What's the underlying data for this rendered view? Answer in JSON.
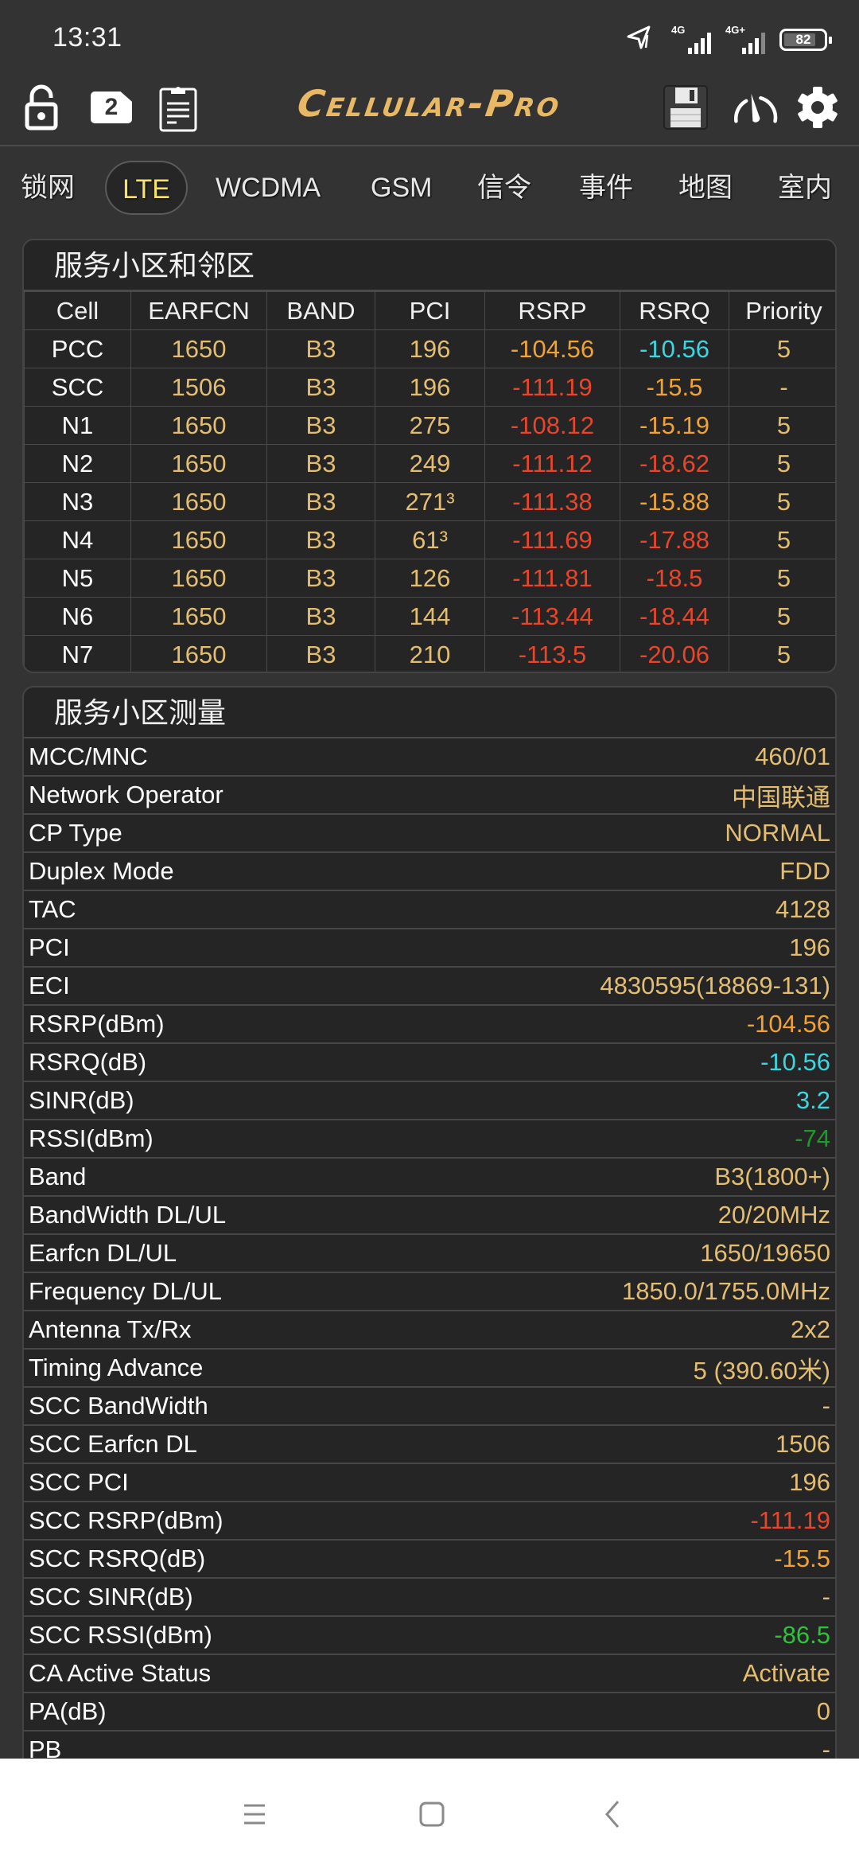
{
  "status_bar": {
    "time": "13:31",
    "sim1_network": "4G",
    "sim2_network": "4G+",
    "battery_level": "82"
  },
  "toolbar": {
    "app_title": "Cellular-Pro",
    "sim_slot": "2",
    "logo_color": "#e8b865"
  },
  "tabs": [
    {
      "label": "锁网",
      "active": false
    },
    {
      "label": "LTE",
      "active": true
    },
    {
      "label": "WCDMA",
      "active": false
    },
    {
      "label": "GSM",
      "active": false
    },
    {
      "label": "信令",
      "active": false
    },
    {
      "label": "事件",
      "active": false
    },
    {
      "label": "地图",
      "active": false
    },
    {
      "label": "室内",
      "active": false
    }
  ],
  "colors": {
    "gold": "#e3bd72",
    "orange": "#f0a234",
    "red": "#e8452a",
    "cyan": "#3dd6e0",
    "green": "#2ec43a",
    "dark_green": "#1f9a2a",
    "active_tab": "#f5e36a"
  },
  "cells_section": {
    "title": "服务小区和邻区",
    "columns": [
      "Cell",
      "EARFCN",
      "BAND",
      "PCI",
      "RSRP",
      "RSRQ",
      "Priority"
    ],
    "rows": [
      {
        "cell": "PCC",
        "earfcn": "1650",
        "band": "B3",
        "pci": "196",
        "rsrp": "-104.56",
        "rsrp_color": "orange",
        "rsrq": "-10.56",
        "rsrq_color": "cyan",
        "priority": "5"
      },
      {
        "cell": "SCC",
        "earfcn": "1506",
        "band": "B3",
        "pci": "196",
        "rsrp": "-111.19",
        "rsrp_color": "red",
        "rsrq": "-15.5",
        "rsrq_color": "orange",
        "priority": "-"
      },
      {
        "cell": "N1",
        "earfcn": "1650",
        "band": "B3",
        "pci": "275",
        "rsrp": "-108.12",
        "rsrp_color": "red",
        "rsrq": "-15.19",
        "rsrq_color": "orange",
        "priority": "5"
      },
      {
        "cell": "N2",
        "earfcn": "1650",
        "band": "B3",
        "pci": "249",
        "rsrp": "-111.12",
        "rsrp_color": "red",
        "rsrq": "-18.62",
        "rsrq_color": "red",
        "priority": "5"
      },
      {
        "cell": "N3",
        "earfcn": "1650",
        "band": "B3",
        "pci": "271³",
        "rsrp": "-111.38",
        "rsrp_color": "red",
        "rsrq": "-15.88",
        "rsrq_color": "orange",
        "priority": "5"
      },
      {
        "cell": "N4",
        "earfcn": "1650",
        "band": "B3",
        "pci": "61³",
        "rsrp": "-111.69",
        "rsrp_color": "red",
        "rsrq": "-17.88",
        "rsrq_color": "red",
        "priority": "5"
      },
      {
        "cell": "N5",
        "earfcn": "1650",
        "band": "B3",
        "pci": "126",
        "rsrp": "-111.81",
        "rsrp_color": "red",
        "rsrq": "-18.5",
        "rsrq_color": "red",
        "priority": "5"
      },
      {
        "cell": "N6",
        "earfcn": "1650",
        "band": "B3",
        "pci": "144",
        "rsrp": "-113.44",
        "rsrp_color": "red",
        "rsrq": "-18.44",
        "rsrq_color": "red",
        "priority": "5"
      },
      {
        "cell": "N7",
        "earfcn": "1650",
        "band": "B3",
        "pci": "210",
        "rsrp": "-113.5",
        "rsrp_color": "red",
        "rsrq": "-20.06",
        "rsrq_color": "red",
        "priority": "5"
      }
    ]
  },
  "measurement_section": {
    "title": "服务小区测量",
    "items": [
      {
        "label": "MCC/MNC",
        "value": "460/01",
        "color": "gold"
      },
      {
        "label": "Network Operator",
        "value": "中国联通",
        "color": "gold"
      },
      {
        "label": "CP Type",
        "value": "NORMAL",
        "color": "gold"
      },
      {
        "label": "Duplex Mode",
        "value": "FDD",
        "color": "gold"
      },
      {
        "label": "TAC",
        "value": "4128",
        "color": "gold"
      },
      {
        "label": "PCI",
        "value": "196",
        "color": "gold"
      },
      {
        "label": "ECI",
        "value": "4830595(18869-131)",
        "color": "gold"
      },
      {
        "label": "RSRP(dBm)",
        "value": "-104.56",
        "color": "orange"
      },
      {
        "label": "RSRQ(dB)",
        "value": "-10.56",
        "color": "cyan"
      },
      {
        "label": "SINR(dB)",
        "value": "3.2",
        "color": "cyan"
      },
      {
        "label": "RSSI(dBm)",
        "value": "-74",
        "color": "dark_green"
      },
      {
        "label": "Band",
        "value": "B3(1800+)",
        "color": "gold"
      },
      {
        "label": "BandWidth DL/UL",
        "value": "20/20MHz",
        "color": "gold"
      },
      {
        "label": "Earfcn DL/UL",
        "value": "1650/19650",
        "color": "gold"
      },
      {
        "label": "Frequency DL/UL",
        "value": "1850.0/1755.0MHz",
        "color": "gold"
      },
      {
        "label": "Antenna Tx/Rx",
        "value": "2x2",
        "color": "gold"
      },
      {
        "label": "Timing Advance",
        "value": "5 (390.60米)",
        "color": "gold"
      },
      {
        "label": "SCC BandWidth",
        "value": "-",
        "color": "gold"
      },
      {
        "label": "SCC Earfcn DL",
        "value": "1506",
        "color": "gold"
      },
      {
        "label": "SCC PCI",
        "value": "196",
        "color": "gold"
      },
      {
        "label": "SCC RSRP(dBm)",
        "value": "-111.19",
        "color": "red"
      },
      {
        "label": "SCC RSRQ(dB)",
        "value": "-15.5",
        "color": "orange"
      },
      {
        "label": "SCC SINR(dB)",
        "value": "-",
        "color": "gold"
      },
      {
        "label": "SCC RSSI(dBm)",
        "value": "-86.5",
        "color": "green"
      },
      {
        "label": "CA Active Status",
        "value": "Activate",
        "color": "gold"
      },
      {
        "label": "PA(dB)",
        "value": "0",
        "color": "gold"
      },
      {
        "label": "PB",
        "value": "-",
        "color": "gold"
      }
    ]
  }
}
